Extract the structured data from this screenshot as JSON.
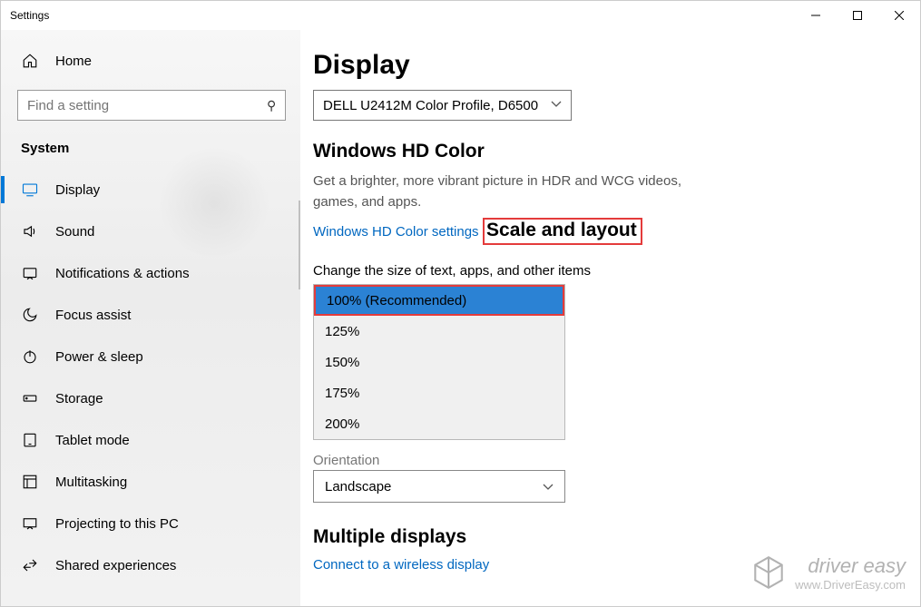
{
  "window": {
    "title": "Settings"
  },
  "sidebar": {
    "home": "Home",
    "search_placeholder": "Find a setting",
    "category": "System",
    "items": [
      {
        "label": "Display"
      },
      {
        "label": "Sound"
      },
      {
        "label": "Notifications & actions"
      },
      {
        "label": "Focus assist"
      },
      {
        "label": "Power & sleep"
      },
      {
        "label": "Storage"
      },
      {
        "label": "Tablet mode"
      },
      {
        "label": "Multitasking"
      },
      {
        "label": "Projecting to this PC"
      },
      {
        "label": "Shared experiences"
      }
    ]
  },
  "main": {
    "title": "Display",
    "color_profile": "DELL U2412M Color Profile, D6500",
    "hd": {
      "heading": "Windows HD Color",
      "desc": "Get a brighter, more vibrant picture in HDR and WCG videos, games, and apps.",
      "link": "Windows HD Color settings"
    },
    "scale": {
      "heading": "Scale and layout",
      "label": "Change the size of text, apps, and other items",
      "options": [
        "100% (Recommended)",
        "125%",
        "150%",
        "175%",
        "200%"
      ]
    },
    "orientation": {
      "label": "Orientation",
      "value": "Landscape"
    },
    "multi": {
      "heading": "Multiple displays",
      "link": "Connect to a wireless display"
    }
  },
  "watermark": {
    "brand": "driver easy",
    "url": "www.DriverEasy.com"
  }
}
